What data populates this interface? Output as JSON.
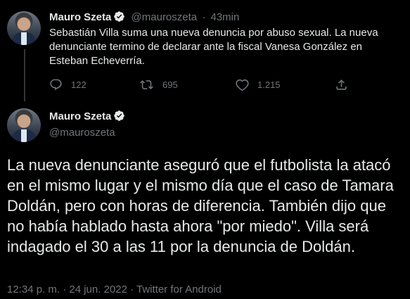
{
  "reply_tweet": {
    "author_name": "Mauro Szeta",
    "handle": "@mauroszeta",
    "separator": "·",
    "time_ago": "43min",
    "text": "Sebastián Villa suma una nueva denuncia por abuso sexual. La nueva denunciante termino de declarar ante la fiscal Vanesa González en Esteban Echeverría.",
    "replies": "122",
    "retweets": "695",
    "likes": "1.215"
  },
  "main_tweet": {
    "author_name": "Mauro Szeta",
    "handle": "@mauroszeta",
    "text": "La nueva denunciante aseguró que el futbolista la atacó en el mismo lugar y el mismo día que el caso de Tamara Doldán, pero con horas de diferencia. También dijo que no había hablado hasta ahora \"por miedo\". Villa será indagado el 30 a las 11 por la denuncia de Doldán.",
    "timestamp": "12:34 p. m. · 24 jun. 2022 · Twitter for Android"
  },
  "colors": {
    "background": "#000000",
    "text": "#e7e9ea",
    "muted": "#71767b",
    "verified_badge": "#e7e9ea"
  },
  "icons": [
    "verified-badge-icon",
    "reply-icon",
    "retweet-icon",
    "like-icon",
    "share-icon"
  ]
}
